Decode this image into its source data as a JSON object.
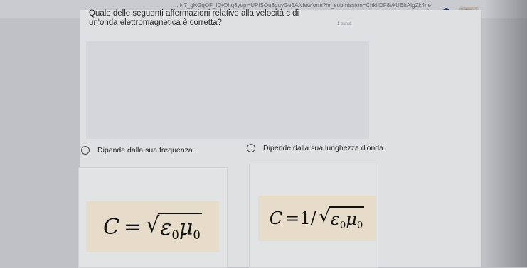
{
  "browser": {
    "url": "...N7_gKGqOF_IQtOhq8yttpHUPfSOu8guyGe5A/viewform?hr_submission=ChkIIDF8vkUEhAIgZk4ne",
    "account_label": "Errore 1"
  },
  "question": {
    "text": "Quale delle seguenti affermazioni relative alla velocità c di un'onda elettromagnetica è corretta?",
    "points": "1 punto"
  },
  "options": [
    {
      "label": "Dipende dalla sua frequenza."
    },
    {
      "label": "Dipende dalla sua lunghezza d'onda."
    }
  ],
  "formulas": {
    "f1": {
      "lhs": "C",
      "eq": "=",
      "radicand_a": "ε",
      "sub_a": "0",
      "radicand_b": "μ",
      "sub_b": "0"
    },
    "f2": {
      "lhs": "C",
      "eq": "=1/",
      "radicand_a": "ε",
      "sub_a": "0",
      "radicand_b": "μ",
      "sub_b": "0"
    }
  }
}
